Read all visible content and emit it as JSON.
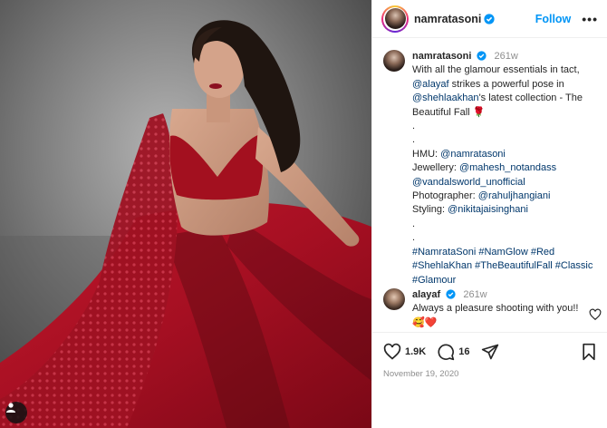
{
  "post": {
    "author": "namratasoni",
    "follow_label": "Follow",
    "more_label": "•••",
    "caption_time": "261w",
    "caption_lines": [
      [
        {
          "t": "With all the glamour essentials in tact,",
          "k": "text"
        }
      ],
      [
        {
          "t": "@alayaf",
          "k": "link"
        },
        {
          "t": " strikes a powerful pose in",
          "k": "text"
        }
      ],
      [
        {
          "t": "@shehlaakhan",
          "k": "link"
        },
        {
          "t": "'s latest collection - The",
          "k": "text"
        }
      ],
      [
        {
          "t": "Beautiful Fall 🌹",
          "k": "text"
        }
      ],
      [
        {
          "t": ".",
          "k": "text"
        }
      ],
      [
        {
          "t": ".",
          "k": "text"
        }
      ],
      [
        {
          "t": "HMU: ",
          "k": "text"
        },
        {
          "t": "@namratasoni",
          "k": "link"
        }
      ],
      [
        {
          "t": "Jewellery: ",
          "k": "text"
        },
        {
          "t": "@mahesh_notandass",
          "k": "link"
        }
      ],
      [
        {
          "t": "@vandalsworld_unofficial",
          "k": "link"
        }
      ],
      [
        {
          "t": "Photographer: ",
          "k": "text"
        },
        {
          "t": "@rahuljhangiani",
          "k": "link"
        }
      ],
      [
        {
          "t": "Styling: ",
          "k": "text"
        },
        {
          "t": "@nikitajaisinghani",
          "k": "link"
        }
      ],
      [
        {
          "t": ".",
          "k": "text"
        }
      ],
      [
        {
          "t": ".",
          "k": "text"
        }
      ],
      [
        {
          "t": "#NamrataSoni #NamGlow #Red",
          "k": "link"
        }
      ],
      [
        {
          "t": "#ShehlaKhan #TheBeautifulFall #Classic",
          "k": "link"
        }
      ],
      [
        {
          "t": "#Glamour",
          "k": "link"
        }
      ]
    ]
  },
  "comment": {
    "user": "alayaf",
    "time": "261w",
    "line1": "Always a pleasure shooting with you!!",
    "line2": "🥰❤️"
  },
  "actions": {
    "likes": "1.9K",
    "comments": "16",
    "date": "November 19, 2020"
  },
  "icons": [
    "user-icon",
    "verified-badge-icon",
    "heart-icon",
    "comment-icon",
    "share-icon",
    "bookmark-icon",
    "like-comment-icon"
  ],
  "colors": {
    "link": "#00376b",
    "follow": "#0095f6",
    "verified": "#0095f6",
    "muted": "#8e8e8e"
  }
}
